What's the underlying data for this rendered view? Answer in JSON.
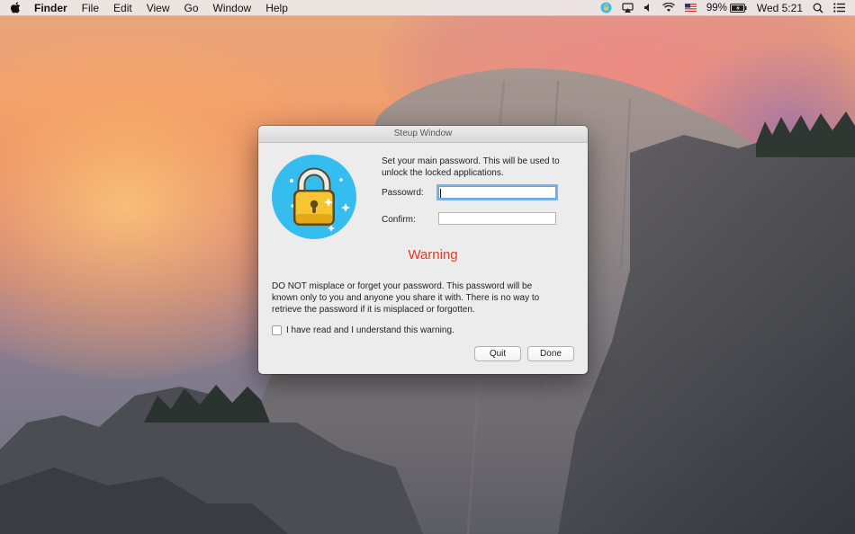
{
  "menubar": {
    "app_name": "Finder",
    "menus": [
      "File",
      "Edit",
      "View",
      "Go",
      "Window",
      "Help"
    ],
    "status": {
      "battery_percent": "99%",
      "clock": "Wed 5:21"
    },
    "icons": [
      "apple-logo-icon",
      "app-status-icon",
      "airplay-icon",
      "volume-icon",
      "wifi-icon",
      "us-flag-icon",
      "battery-icon",
      "spotlight-search-icon",
      "notification-center-icon"
    ]
  },
  "window": {
    "title": "Steup Window",
    "intro": "Set your main password. This will be used to unlock the locked applications.",
    "password_label": "Passowrd:",
    "password_value": "",
    "confirm_label": "Confirm:",
    "confirm_value": "",
    "warning_title": "Warning",
    "warning_text": "DO NOT misplace or forget your password. This password will be known only to you and anyone you share it with. There is no way to retrieve the password if it is misplaced or forgotten.",
    "checkbox_label": "I have read and I understand this warning.",
    "checkbox_checked": false,
    "quit_label": "Quit",
    "done_label": "Done"
  },
  "colors": {
    "warning": "#e63a22",
    "lock_circle": "#36bdf0",
    "lock_body": "#f7c531"
  }
}
